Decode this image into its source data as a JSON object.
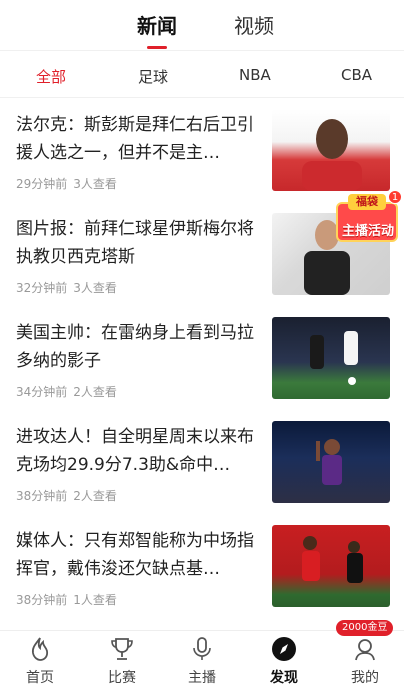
{
  "header": {
    "tabs": [
      {
        "label": "新闻",
        "active": true
      },
      {
        "label": "视频",
        "active": false
      }
    ]
  },
  "categories": [
    {
      "label": "全部",
      "active": true
    },
    {
      "label": "足球",
      "active": false
    },
    {
      "label": "NBA",
      "active": false
    },
    {
      "label": "CBA",
      "active": false
    }
  ],
  "articles": [
    {
      "title": "法尔克：斯彭斯是拜仁右后卫引援人选之一，但并不是主…",
      "time": "29分钟前",
      "views": "3人查看"
    },
    {
      "title": "图片报：前拜仁球星伊斯梅尔将执教贝西克塔斯",
      "time": "32分钟前",
      "views": "3人查看"
    },
    {
      "title": "美国主帅：在雷纳身上看到马拉多纳的影子",
      "time": "34分钟前",
      "views": "2人查看"
    },
    {
      "title": "进攻达人！自全明星周末以来布克场均29.9分7.3助&命中…",
      "time": "38分钟前",
      "views": "2人查看"
    },
    {
      "title": "媒体人：只有郑智能称为中场指挥官，戴伟浚还欠缺点基…",
      "time": "38分钟前",
      "views": "1人查看"
    }
  ],
  "promo": {
    "ribbon": "福袋",
    "label": "主播活动",
    "count": "1"
  },
  "bottom_nav": [
    {
      "label": "首页",
      "icon": "flame-icon",
      "active": false
    },
    {
      "label": "比赛",
      "icon": "trophy-icon",
      "active": false
    },
    {
      "label": "主播",
      "icon": "microphone-icon",
      "active": false
    },
    {
      "label": "发现",
      "icon": "compass-icon",
      "active": true
    },
    {
      "label": "我的",
      "icon": "profile-icon",
      "active": false
    }
  ],
  "coins_badge": "2000金豆",
  "colors": {
    "accent": "#e0202a"
  }
}
